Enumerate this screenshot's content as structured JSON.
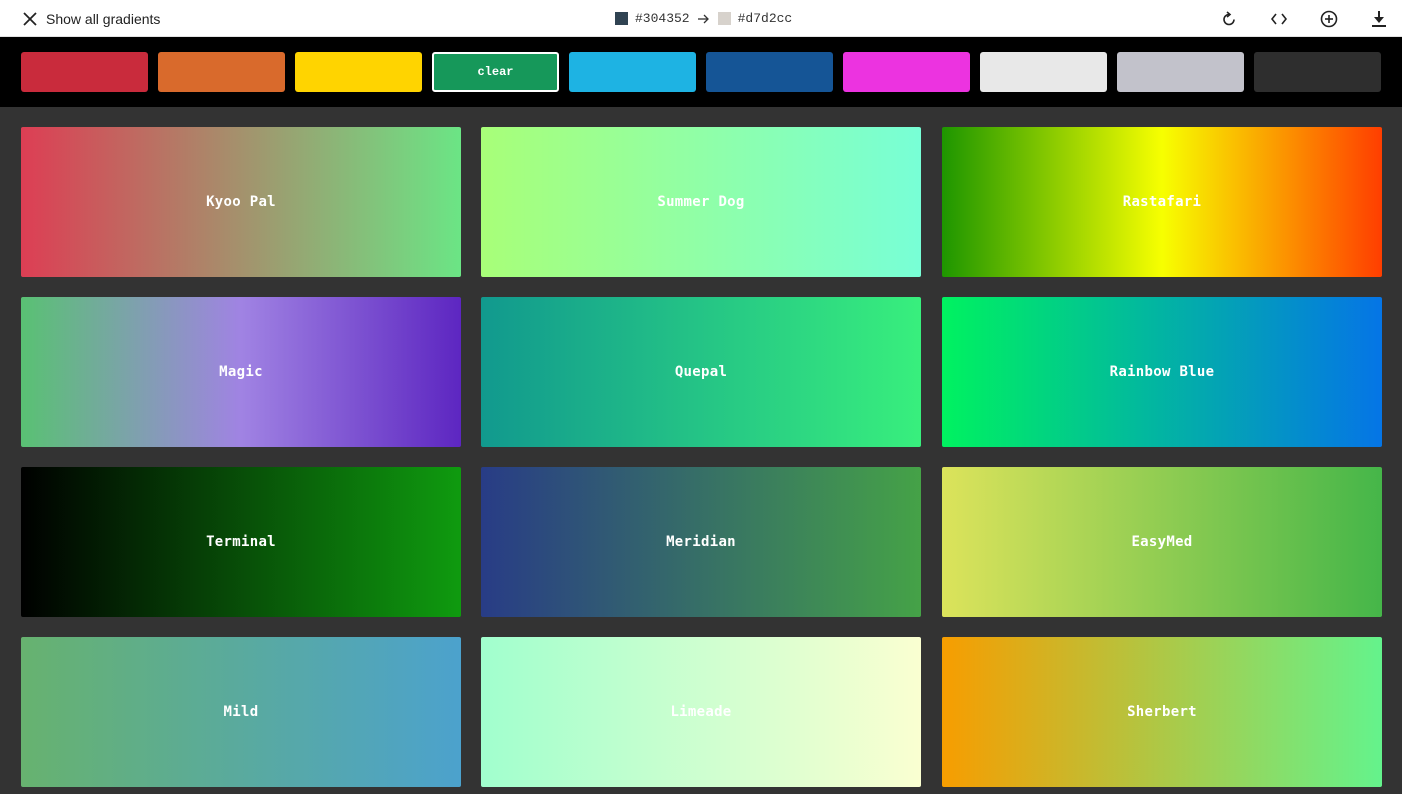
{
  "topbar": {
    "show_all_label": "Show all gradients",
    "from_hex": "#304352",
    "to_hex": "#d7d2cc",
    "from_color": "#304352",
    "to_color": "#d7d2cc",
    "tools": [
      "rotate-icon",
      "code-icon",
      "add-icon",
      "download-icon"
    ]
  },
  "filters": {
    "active_label": "clear",
    "chips": [
      {
        "name": "red",
        "color": "#c92b3c"
      },
      {
        "name": "orange",
        "color": "#d96a2c"
      },
      {
        "name": "yellow",
        "color": "#ffd400"
      },
      {
        "name": "green",
        "color": "#16985a"
      },
      {
        "name": "cyan",
        "color": "#1eb3e3"
      },
      {
        "name": "blue",
        "color": "#155596"
      },
      {
        "name": "magenta",
        "color": "#ec33e0"
      },
      {
        "name": "white",
        "color": "#e8e8e8"
      },
      {
        "name": "grey",
        "color": "#c2c2cb"
      },
      {
        "name": "black",
        "color": "#2e2e2e"
      }
    ]
  },
  "gradients": [
    {
      "name": "Kyoo Pal",
      "from": "#dd3e54",
      "to": "#6be585"
    },
    {
      "name": "Summer Dog",
      "from": "#a8ff78",
      "to": "#78ffd6"
    },
    {
      "name": "Rastafari",
      "mid": "#f7ff00",
      "from": "#1e9600",
      "to": "#ff3e00"
    },
    {
      "name": "Magic",
      "mid": "#a083e3",
      "from": "#59c173",
      "to": "#5d26c1"
    },
    {
      "name": "Quepal",
      "from": "#11998e",
      "to": "#38ef7d"
    },
    {
      "name": "Rainbow Blue",
      "from": "#00f260",
      "to": "#0575e6"
    },
    {
      "name": "Terminal",
      "from": "#000000",
      "to": "#0f9b0f"
    },
    {
      "name": "Meridian",
      "from": "#283c86",
      "to": "#45a247"
    },
    {
      "name": "EasyMed",
      "from": "#dce35b",
      "to": "#45b649"
    },
    {
      "name": "Mild",
      "from": "#67b26f",
      "to": "#4ca2cd"
    },
    {
      "name": "Limeade",
      "from": "#a1ffce",
      "to": "#faffd1"
    },
    {
      "name": "Sherbert",
      "from": "#f79d00",
      "to": "#64f38c"
    }
  ]
}
